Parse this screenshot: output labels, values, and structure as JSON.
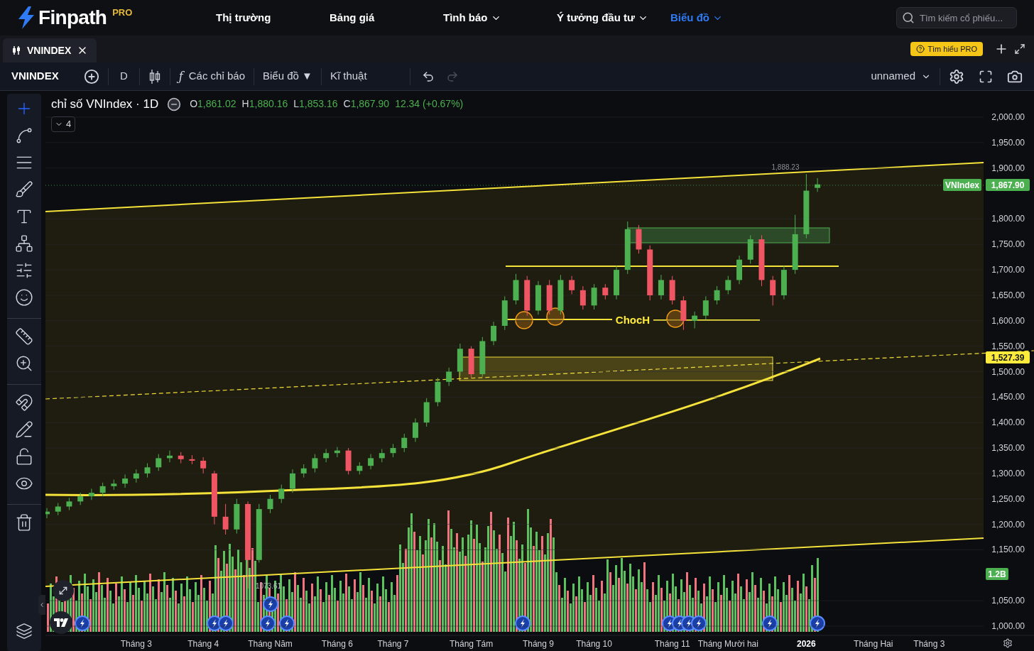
{
  "logo": {
    "name": "Finpath",
    "badge": "PRO"
  },
  "nav": [
    {
      "label": "Thị trường",
      "has_menu": false,
      "selected": false
    },
    {
      "label": "Bảng giá",
      "has_menu": false,
      "selected": false
    },
    {
      "label": "Tình báo",
      "has_menu": true,
      "selected": false
    },
    {
      "label": "Ý tưởng đầu tư",
      "has_menu": true,
      "selected": false
    },
    {
      "label": "Biểu đồ",
      "has_menu": true,
      "selected": true
    }
  ],
  "search": {
    "placeholder": "Tìm kiếm cổ phiếu..."
  },
  "tabs": [
    {
      "label": "VNINDEX",
      "selected": true
    }
  ],
  "pro_button": "Tìm hiểu PRO",
  "toolbar": {
    "symbol": "VNINDEX",
    "interval": "D",
    "indicators_icon": "ƒ",
    "indicators": "Các chỉ báo",
    "chart_type": "Biểu đồ ▼",
    "technical": "Kĩ thuật",
    "redo_disabled": true,
    "layout_name": "unnamed"
  },
  "tool_groups": [
    {
      "tools": [
        {
          "kind": "crosshair",
          "selected": true
        },
        {
          "kind": "trend-line",
          "selected": false
        },
        {
          "kind": "fib",
          "selected": false
        },
        {
          "kind": "brush",
          "selected": false
        },
        {
          "kind": "text",
          "selected": false
        },
        {
          "kind": "pattern",
          "selected": false
        },
        {
          "kind": "forecast",
          "selected": false
        },
        {
          "kind": "emoji",
          "selected": false
        }
      ]
    },
    {
      "tools": [
        {
          "kind": "ruler",
          "selected": false
        },
        {
          "kind": "zoom",
          "selected": false
        }
      ]
    },
    {
      "tools": [
        {
          "kind": "magnet",
          "selected": false
        },
        {
          "kind": "lock-drawing",
          "selected": false
        },
        {
          "kind": "lock",
          "selected": false
        },
        {
          "kind": "eye",
          "selected": false
        }
      ]
    },
    {
      "tools": [
        {
          "kind": "trash",
          "selected": false
        }
      ]
    }
  ],
  "legend": {
    "title": "chỉ số VNIndex · 1D",
    "ohlc": [
      {
        "label": "O",
        "value": "1,861.02"
      },
      {
        "label": "H",
        "value": "1,880.16"
      },
      {
        "label": "L",
        "value": "1,853.16"
      },
      {
        "label": "C",
        "value": "1,867.90"
      }
    ],
    "change": "12.34 (+0.67%)",
    "hidden_count": "4"
  },
  "price_tags": [
    {
      "kind": "series",
      "name": "VNIndex",
      "value": "1,867.90"
    },
    {
      "kind": "indicator",
      "value": "1,527.39"
    },
    {
      "kind": "volume",
      "value": "1.2B"
    }
  ],
  "chart_data": {
    "type": "candlestick",
    "grid": true,
    "ylim": [
      1000,
      2000
    ],
    "yticks": [
      {
        "value": 2000,
        "label": "2,000.00"
      },
      {
        "value": 1950,
        "label": "1,950.00"
      },
      {
        "value": 1900,
        "label": "1,900.00"
      },
      {
        "value": 1800,
        "label": "1,800.00"
      },
      {
        "value": 1750,
        "label": "1,750.00"
      },
      {
        "value": 1700,
        "label": "1,700.00"
      },
      {
        "value": 1650,
        "label": "1,650.00"
      },
      {
        "value": 1600,
        "label": "1,600.00"
      },
      {
        "value": 1550,
        "label": "1,550.00"
      },
      {
        "value": 1500,
        "label": "1,500.00"
      },
      {
        "value": 1450,
        "label": "1,450.00"
      },
      {
        "value": 1400,
        "label": "1,400.00"
      },
      {
        "value": 1350,
        "label": "1,350.00"
      },
      {
        "value": 1300,
        "label": "1,300.00"
      },
      {
        "value": 1250,
        "label": "1,250.00"
      },
      {
        "value": 1200,
        "label": "1,200.00"
      },
      {
        "value": 1150,
        "label": "1,150.00"
      },
      {
        "value": 1050,
        "label": "1,050.00"
      },
      {
        "value": 1000,
        "label": "1,000.00"
      }
    ],
    "categories": [
      null,
      null,
      null,
      null,
      null,
      null,
      null,
      null,
      "Tháng 3",
      null,
      null,
      null,
      null,
      null,
      "Tháng 4",
      null,
      null,
      null,
      null,
      null,
      "Tháng Năm",
      null,
      null,
      null,
      null,
      null,
      "Tháng 6",
      null,
      null,
      null,
      null,
      "Tháng 7",
      null,
      null,
      null,
      null,
      null,
      null,
      "Tháng Tám",
      null,
      null,
      null,
      null,
      null,
      "Tháng 9",
      null,
      null,
      null,
      null,
      "Tháng 10",
      null,
      null,
      null,
      null,
      null,
      null,
      "Tháng 11",
      null,
      null,
      null,
      null,
      "Tháng Mười hai",
      null,
      null,
      null,
      null,
      null,
      null,
      "2026",
      null,
      null,
      null,
      null,
      null,
      "Tháng Hai",
      null,
      null,
      null,
      null,
      "Tháng 3",
      null,
      null,
      null,
      null
    ],
    "ohlc": [
      [
        1220,
        1232,
        1212,
        1225
      ],
      [
        1225,
        1242,
        1218,
        1235
      ],
      [
        1235,
        1252,
        1228,
        1245
      ],
      [
        1245,
        1262,
        1238,
        1255
      ],
      [
        1255,
        1270,
        1248,
        1262
      ],
      [
        1262,
        1282,
        1255,
        1275
      ],
      [
        1275,
        1288,
        1268,
        1280
      ],
      [
        1280,
        1298,
        1272,
        1290
      ],
      [
        1290,
        1308,
        1282,
        1300
      ],
      [
        1300,
        1320,
        1292,
        1312
      ],
      [
        1312,
        1338,
        1305,
        1330
      ],
      [
        1330,
        1345,
        1322,
        1335
      ],
      [
        1335,
        1342,
        1320,
        1328
      ],
      [
        1328,
        1336,
        1318,
        1325
      ],
      [
        1325,
        1332,
        1300,
        1310
      ],
      [
        1300,
        1305,
        1200,
        1215
      ],
      [
        1215,
        1240,
        1180,
        1190
      ],
      [
        1190,
        1250,
        1182,
        1240
      ],
      [
        1240,
        1245,
        1073.61,
        1130
      ],
      [
        1130,
        1240,
        1125,
        1230
      ],
      [
        1230,
        1258,
        1222,
        1250
      ],
      [
        1250,
        1278,
        1242,
        1270
      ],
      [
        1270,
        1308,
        1262,
        1300
      ],
      [
        1300,
        1318,
        1292,
        1310
      ],
      [
        1310,
        1338,
        1302,
        1330
      ],
      [
        1330,
        1348,
        1322,
        1340
      ],
      [
        1340,
        1352,
        1332,
        1345
      ],
      [
        1345,
        1350,
        1298,
        1305
      ],
      [
        1305,
        1322,
        1298,
        1315
      ],
      [
        1315,
        1338,
        1308,
        1330
      ],
      [
        1330,
        1348,
        1322,
        1340
      ],
      [
        1340,
        1358,
        1332,
        1350
      ],
      [
        1350,
        1378,
        1342,
        1370
      ],
      [
        1370,
        1408,
        1362,
        1400
      ],
      [
        1400,
        1448,
        1392,
        1440
      ],
      [
        1440,
        1488,
        1432,
        1480
      ],
      [
        1480,
        1508,
        1472,
        1500
      ],
      [
        1500,
        1555,
        1492,
        1545
      ],
      [
        1545,
        1550,
        1488,
        1495
      ],
      [
        1495,
        1568,
        1490,
        1560
      ],
      [
        1560,
        1598,
        1552,
        1590
      ],
      [
        1590,
        1648,
        1582,
        1640
      ],
      [
        1640,
        1692,
        1632,
        1680
      ],
      [
        1680,
        1688,
        1610,
        1620
      ],
      [
        1620,
        1678,
        1612,
        1670
      ],
      [
        1670,
        1680,
        1612,
        1620
      ],
      [
        1620,
        1690,
        1612,
        1680
      ],
      [
        1680,
        1688,
        1652,
        1660
      ],
      [
        1660,
        1668,
        1622,
        1630
      ],
      [
        1630,
        1672,
        1622,
        1665
      ],
      [
        1665,
        1672,
        1642,
        1650
      ],
      [
        1650,
        1708,
        1642,
        1700
      ],
      [
        1700,
        1795,
        1692,
        1780
      ],
      [
        1780,
        1788,
        1732,
        1740
      ],
      [
        1740,
        1748,
        1640,
        1650
      ],
      [
        1650,
        1690,
        1642,
        1680
      ],
      [
        1680,
        1688,
        1632,
        1640
      ],
      [
        1640,
        1648,
        1582,
        1600
      ],
      [
        1600,
        1618,
        1585,
        1610
      ],
      [
        1610,
        1648,
        1602,
        1640
      ],
      [
        1640,
        1668,
        1632,
        1660
      ],
      [
        1660,
        1688,
        1652,
        1680
      ],
      [
        1680,
        1728,
        1672,
        1720
      ],
      [
        1720,
        1768,
        1712,
        1760
      ],
      [
        1760,
        1768,
        1668,
        1680
      ],
      [
        1680,
        1688,
        1630,
        1650
      ],
      [
        1650,
        1708,
        1642,
        1700
      ],
      [
        1700,
        1808,
        1692,
        1770
      ],
      [
        1770,
        1888.23,
        1762,
        1855.56
      ],
      [
        1861.02,
        1880.16,
        1853.16,
        1867.9
      ],
      null,
      null,
      null,
      null,
      null,
      null,
      null,
      null,
      null,
      null,
      null,
      null,
      null,
      null
    ],
    "annotations": [
      {
        "text": "1,888.23"
      },
      {
        "text": "1073.61"
      },
      {
        "text": "ChocH"
      }
    ]
  }
}
